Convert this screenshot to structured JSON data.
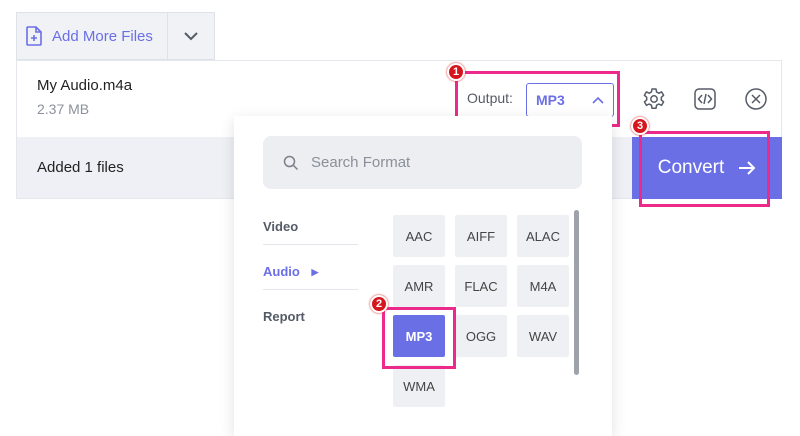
{
  "toolbar": {
    "add_more_files": "Add More Files"
  },
  "file": {
    "name": "My Audio.m4a",
    "size": "2.37 MB"
  },
  "status": {
    "added": "Added 1 files"
  },
  "output": {
    "label": "Output:",
    "value": "MP3"
  },
  "convert": {
    "label": "Convert"
  },
  "search": {
    "placeholder": "Search Format"
  },
  "categories": [
    {
      "label": "Video"
    },
    {
      "label": "Audio"
    },
    {
      "label": "Report"
    }
  ],
  "formats": [
    "AAC",
    "AIFF",
    "ALAC",
    "AMR",
    "FLAC",
    "M4A",
    "MP3",
    "OGG",
    "WAV",
    "WMA"
  ],
  "selected_format": "MP3",
  "badges": [
    "1",
    "2",
    "3"
  ],
  "colors": {
    "accent": "#6b6fe6",
    "highlight": "#ec2a8b",
    "badge": "#d7151d"
  }
}
